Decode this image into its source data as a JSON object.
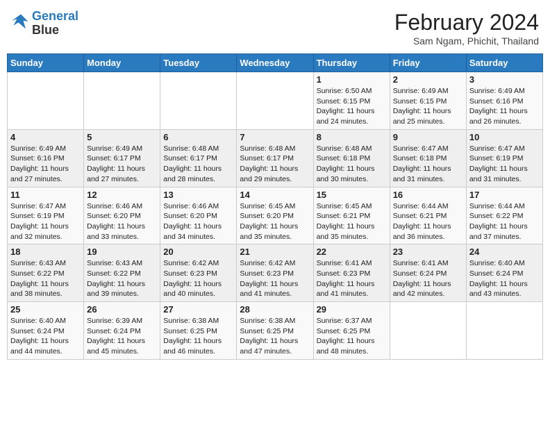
{
  "logo": {
    "line1": "General",
    "line2": "Blue"
  },
  "title": {
    "month_year": "February 2024",
    "location": "Sam Ngam, Phichit, Thailand"
  },
  "weekdays": [
    "Sunday",
    "Monday",
    "Tuesday",
    "Wednesday",
    "Thursday",
    "Friday",
    "Saturday"
  ],
  "weeks": [
    [
      {
        "day": "",
        "info": ""
      },
      {
        "day": "",
        "info": ""
      },
      {
        "day": "",
        "info": ""
      },
      {
        "day": "",
        "info": ""
      },
      {
        "day": "1",
        "info": "Sunrise: 6:50 AM\nSunset: 6:15 PM\nDaylight: 11 hours and 24 minutes."
      },
      {
        "day": "2",
        "info": "Sunrise: 6:49 AM\nSunset: 6:15 PM\nDaylight: 11 hours and 25 minutes."
      },
      {
        "day": "3",
        "info": "Sunrise: 6:49 AM\nSunset: 6:16 PM\nDaylight: 11 hours and 26 minutes."
      }
    ],
    [
      {
        "day": "4",
        "info": "Sunrise: 6:49 AM\nSunset: 6:16 PM\nDaylight: 11 hours and 27 minutes."
      },
      {
        "day": "5",
        "info": "Sunrise: 6:49 AM\nSunset: 6:17 PM\nDaylight: 11 hours and 27 minutes."
      },
      {
        "day": "6",
        "info": "Sunrise: 6:48 AM\nSunset: 6:17 PM\nDaylight: 11 hours and 28 minutes."
      },
      {
        "day": "7",
        "info": "Sunrise: 6:48 AM\nSunset: 6:17 PM\nDaylight: 11 hours and 29 minutes."
      },
      {
        "day": "8",
        "info": "Sunrise: 6:48 AM\nSunset: 6:18 PM\nDaylight: 11 hours and 30 minutes."
      },
      {
        "day": "9",
        "info": "Sunrise: 6:47 AM\nSunset: 6:18 PM\nDaylight: 11 hours and 31 minutes."
      },
      {
        "day": "10",
        "info": "Sunrise: 6:47 AM\nSunset: 6:19 PM\nDaylight: 11 hours and 31 minutes."
      }
    ],
    [
      {
        "day": "11",
        "info": "Sunrise: 6:47 AM\nSunset: 6:19 PM\nDaylight: 11 hours and 32 minutes."
      },
      {
        "day": "12",
        "info": "Sunrise: 6:46 AM\nSunset: 6:20 PM\nDaylight: 11 hours and 33 minutes."
      },
      {
        "day": "13",
        "info": "Sunrise: 6:46 AM\nSunset: 6:20 PM\nDaylight: 11 hours and 34 minutes."
      },
      {
        "day": "14",
        "info": "Sunrise: 6:45 AM\nSunset: 6:20 PM\nDaylight: 11 hours and 35 minutes."
      },
      {
        "day": "15",
        "info": "Sunrise: 6:45 AM\nSunset: 6:21 PM\nDaylight: 11 hours and 35 minutes."
      },
      {
        "day": "16",
        "info": "Sunrise: 6:44 AM\nSunset: 6:21 PM\nDaylight: 11 hours and 36 minutes."
      },
      {
        "day": "17",
        "info": "Sunrise: 6:44 AM\nSunset: 6:22 PM\nDaylight: 11 hours and 37 minutes."
      }
    ],
    [
      {
        "day": "18",
        "info": "Sunrise: 6:43 AM\nSunset: 6:22 PM\nDaylight: 11 hours and 38 minutes."
      },
      {
        "day": "19",
        "info": "Sunrise: 6:43 AM\nSunset: 6:22 PM\nDaylight: 11 hours and 39 minutes."
      },
      {
        "day": "20",
        "info": "Sunrise: 6:42 AM\nSunset: 6:23 PM\nDaylight: 11 hours and 40 minutes."
      },
      {
        "day": "21",
        "info": "Sunrise: 6:42 AM\nSunset: 6:23 PM\nDaylight: 11 hours and 41 minutes."
      },
      {
        "day": "22",
        "info": "Sunrise: 6:41 AM\nSunset: 6:23 PM\nDaylight: 11 hours and 41 minutes."
      },
      {
        "day": "23",
        "info": "Sunrise: 6:41 AM\nSunset: 6:24 PM\nDaylight: 11 hours and 42 minutes."
      },
      {
        "day": "24",
        "info": "Sunrise: 6:40 AM\nSunset: 6:24 PM\nDaylight: 11 hours and 43 minutes."
      }
    ],
    [
      {
        "day": "25",
        "info": "Sunrise: 6:40 AM\nSunset: 6:24 PM\nDaylight: 11 hours and 44 minutes."
      },
      {
        "day": "26",
        "info": "Sunrise: 6:39 AM\nSunset: 6:24 PM\nDaylight: 11 hours and 45 minutes."
      },
      {
        "day": "27",
        "info": "Sunrise: 6:38 AM\nSunset: 6:25 PM\nDaylight: 11 hours and 46 minutes."
      },
      {
        "day": "28",
        "info": "Sunrise: 6:38 AM\nSunset: 6:25 PM\nDaylight: 11 hours and 47 minutes."
      },
      {
        "day": "29",
        "info": "Sunrise: 6:37 AM\nSunset: 6:25 PM\nDaylight: 11 hours and 48 minutes."
      },
      {
        "day": "",
        "info": ""
      },
      {
        "day": "",
        "info": ""
      }
    ]
  ]
}
